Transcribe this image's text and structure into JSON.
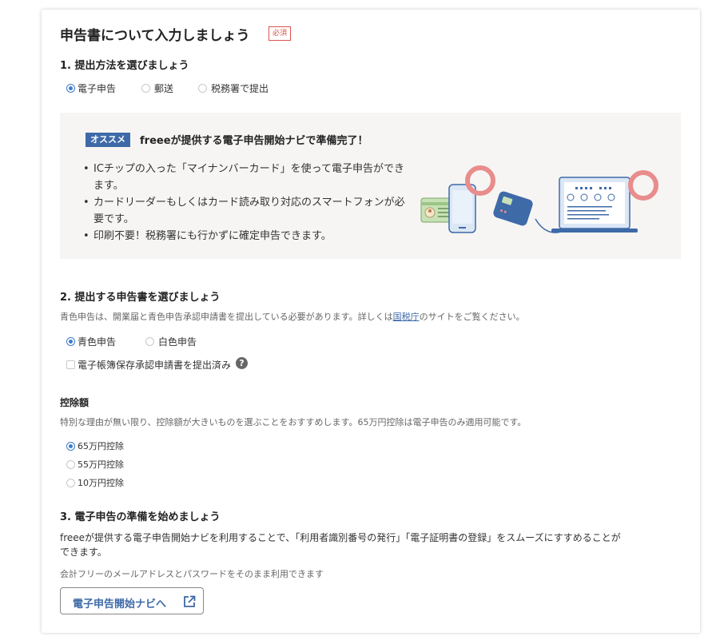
{
  "header": {
    "title": "申告書について入力しましょう",
    "required_badge": "必須"
  },
  "section1": {
    "heading": "1. 提出方法を選びましょう",
    "options": [
      {
        "label": "電子申告",
        "checked": true
      },
      {
        "label": "郵送",
        "checked": false
      },
      {
        "label": "税務署で提出",
        "checked": false
      }
    ]
  },
  "recommend": {
    "badge": "オススメ",
    "title": "freeeが提供する電子申告開始ナビで準備完了！",
    "bullets": [
      "ICチップの入った「マイナンバーカード」を使って電子申告ができます。",
      "カードリーダーもしくはカード読み取り対応のスマートフォンが必要です。",
      "印刷不要！税務署にも行かずに確定申告できます。"
    ],
    "illustration_icons": [
      "mynumber-card-icon",
      "smartphone-icon",
      "card-reader-icon",
      "laptop-icon"
    ],
    "accent_color": "#e98c8c"
  },
  "section2": {
    "heading": "2. 提出する申告書を選びましょう",
    "desc_before": "青色申告は、開業届と青色申告承認申請書を提出している必要があります。詳しくは",
    "desc_link": "国税庁",
    "desc_after": "のサイトをご覧ください。",
    "options": [
      {
        "label": "青色申告",
        "checked": true
      },
      {
        "label": "白色申告",
        "checked": false
      }
    ],
    "checkbox_label": "電子帳簿保存承認申請書を提出済み",
    "checkbox_checked": false,
    "help_icon": "?"
  },
  "deduction": {
    "heading": "控除額",
    "desc": "特別な理由が無い限り、控除額が大きいものを選ぶことをおすすめします。65万円控除は電子申告のみ適用可能です。",
    "options": [
      {
        "label": "65万円控除",
        "checked": true
      },
      {
        "label": "55万円控除",
        "checked": false
      },
      {
        "label": "10万円控除",
        "checked": false
      }
    ]
  },
  "section3": {
    "heading": "3. 電子申告の準備を始めましょう",
    "desc_line1": "freeeが提供する電子申告開始ナビを利用することで、「利用者識別番号の発行」「電子証明書の登録」をスムーズにすすめることが",
    "desc_line2": "できます。",
    "note": "会計フリーのメールアドレスとパスワードをそのまま利用できます",
    "button_label": "電子申告開始ナビへ",
    "button_icon": "external-link-icon"
  },
  "colors": {
    "accent": "#3e6aa8",
    "radio_checked": "#3d7cc9",
    "required": "#d9534f",
    "panel_bg": "#f6f5f3"
  }
}
